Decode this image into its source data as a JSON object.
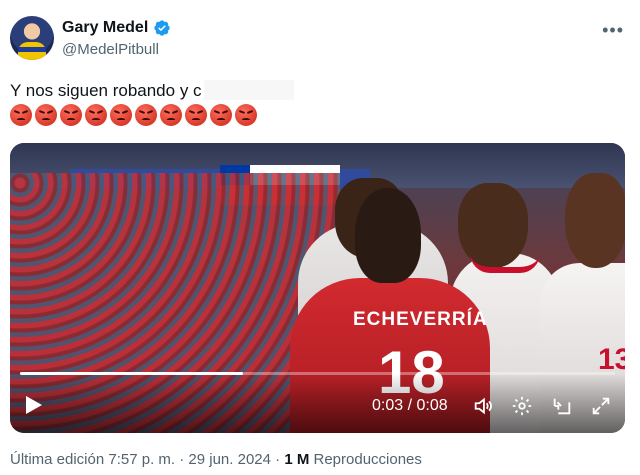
{
  "author": {
    "name": "Gary Medel",
    "handle": "@MedelPitbull",
    "verified_color": "#1d9bf0"
  },
  "tweet": {
    "text": "Y nos siguen robando y c",
    "emoji": "angry-face",
    "emoji_count": 10
  },
  "video": {
    "jersey_name": "ECHEVERRÍA",
    "jersey_number": "18",
    "opponent_number": "13",
    "time": "0:03 / 0:08",
    "progress": 0.375
  },
  "meta": {
    "edited": "Última edición 7:57 p. m. · 29 jun. 2024 ·",
    "views_count": "1 M",
    "views_label": "Reproducciones"
  }
}
